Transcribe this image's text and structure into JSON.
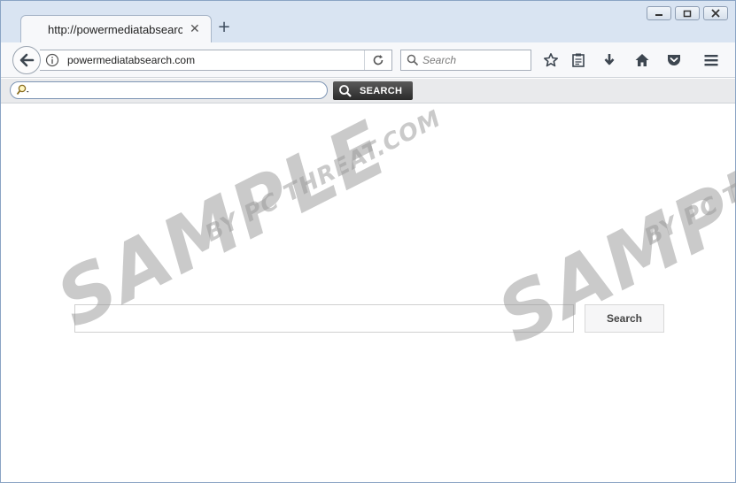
{
  "tab": {
    "title": "http://powermediatabsearch",
    "close_glyph": "✕",
    "new_tab_glyph": "+"
  },
  "navbar": {
    "url": "powermediatabsearch.com",
    "search_placeholder": "Search"
  },
  "toolbar": {
    "search_button_label": "SEARCH",
    "input_value": ""
  },
  "main": {
    "search_value": "",
    "search_button_label": "Search"
  },
  "watermark": {
    "big_text": "SAMPLE",
    "small_text": "BY PC THREAT.COM"
  },
  "icons": {
    "back": "back-arrow-icon",
    "info": "info-icon",
    "reload": "reload-icon",
    "search": "search-icon",
    "bookmark": "star-icon",
    "reading_list": "clipboard-icon",
    "downloads": "download-arrow-icon",
    "home": "home-icon",
    "pocket": "pocket-icon",
    "menu": "hamburger-menu-icon"
  },
  "colors": {
    "tabstrip": "#d9e4f2",
    "toolbar": "#f7f8fa",
    "addonbar": "#e9eaec",
    "addon_button": "#3a3a3a",
    "watermark": "#969696"
  }
}
